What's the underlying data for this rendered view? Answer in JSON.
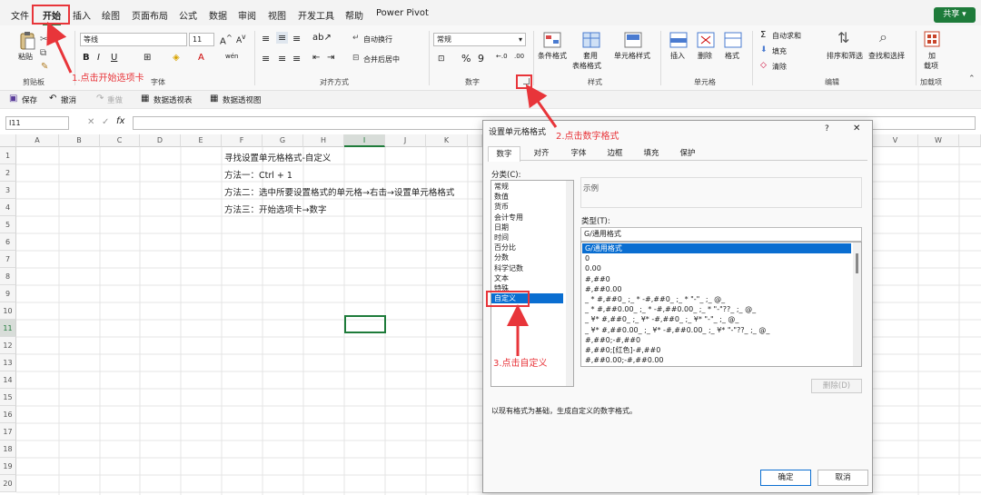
{
  "menu": [
    "文件",
    "开始",
    "插入",
    "绘图",
    "页面布局",
    "公式",
    "数据",
    "审阅",
    "视图",
    "开发工具",
    "帮助",
    "Power Pivot"
  ],
  "share": "共享",
  "ribbon": {
    "paste": "粘贴",
    "font_name": "等线",
    "font_size": "11",
    "wrap": "自动换行",
    "merge": "合并后居中",
    "number_format": "常规",
    "cond": "条件格式",
    "table_fmt1": "套用",
    "table_fmt2": "表格格式",
    "cell_style": "单元格样式",
    "insert": "插入",
    "delete": "删除",
    "format": "格式",
    "autosum": "自动求和",
    "fill": "填充",
    "clear": "清除",
    "sort": "排序和筛选",
    "find": "查找和选择",
    "addin1": "加",
    "addin2": "载项",
    "groups": [
      "剪贴板",
      "字体",
      "对齐方式",
      "数字",
      "样式",
      "单元格",
      "编辑",
      "加载项"
    ]
  },
  "qat": {
    "save": "保存",
    "undo": "撤消",
    "redo": "重做",
    "pivot1": "数据透视表",
    "pivot2": "数据透视图"
  },
  "formula_bar": {
    "name_box": "I11",
    "fx": "fx"
  },
  "columns": [
    "A",
    "B",
    "C",
    "D",
    "E",
    "F",
    "G",
    "H",
    "I",
    "J",
    "K",
    "V",
    "W"
  ],
  "rows": [
    "1",
    "2",
    "3",
    "4",
    "5",
    "6",
    "7",
    "8",
    "9",
    "10",
    "11",
    "12",
    "13",
    "14",
    "15",
    "16",
    "17",
    "18",
    "19",
    "20"
  ],
  "cells": [
    "寻找设置单元格格式-自定义",
    "方法一：Ctrl + 1",
    "方法二：选中所要设置格式的单元格→右击→设置单元格格式",
    "方法三：开始选项卡→数字"
  ],
  "dialog": {
    "title": "设置单元格格式",
    "help": "?",
    "close": "✕",
    "tabs": [
      "数字",
      "对齐",
      "字体",
      "边框",
      "填充",
      "保护"
    ],
    "category_label": "分类(C):",
    "categories": [
      "常规",
      "数值",
      "货币",
      "会计专用",
      "日期",
      "时间",
      "百分比",
      "分数",
      "科学记数",
      "文本",
      "特殊",
      "自定义"
    ],
    "sample_label": "示例",
    "type_label": "类型(T):",
    "type_value": "G/通用格式",
    "formats": [
      "G/通用格式",
      "0",
      "0.00",
      "#,##0",
      "#,##0.00",
      "_ * #,##0_ ;_ * -#,##0_ ;_ * \"-\"_ ;_ @_",
      "_ * #,##0.00_ ;_ * -#,##0.00_ ;_ * \"-\"??_ ;_ @_",
      "_ ¥* #,##0_ ;_ ¥* -#,##0_ ;_ ¥* \"-\"_ ;_ @_",
      "_ ¥* #,##0.00_ ;_ ¥* -#,##0.00_ ;_ ¥* \"-\"??_ ;_ @_",
      "#,##0;-#,##0",
      "#,##0;[红色]-#,##0",
      "#,##0.00;-#,##0.00"
    ],
    "delete": "删除(D)",
    "description": "以现有格式为基础，生成自定义的数字格式。",
    "ok": "确定",
    "cancel": "取消"
  },
  "annotations": [
    "1.点击开始选项卡",
    "2.点击数字格式",
    "3.点击自定义"
  ],
  "colors": {
    "accent": "#1e7b3a",
    "annotation": "#e8353a",
    "selection": "#0a6ed1"
  }
}
